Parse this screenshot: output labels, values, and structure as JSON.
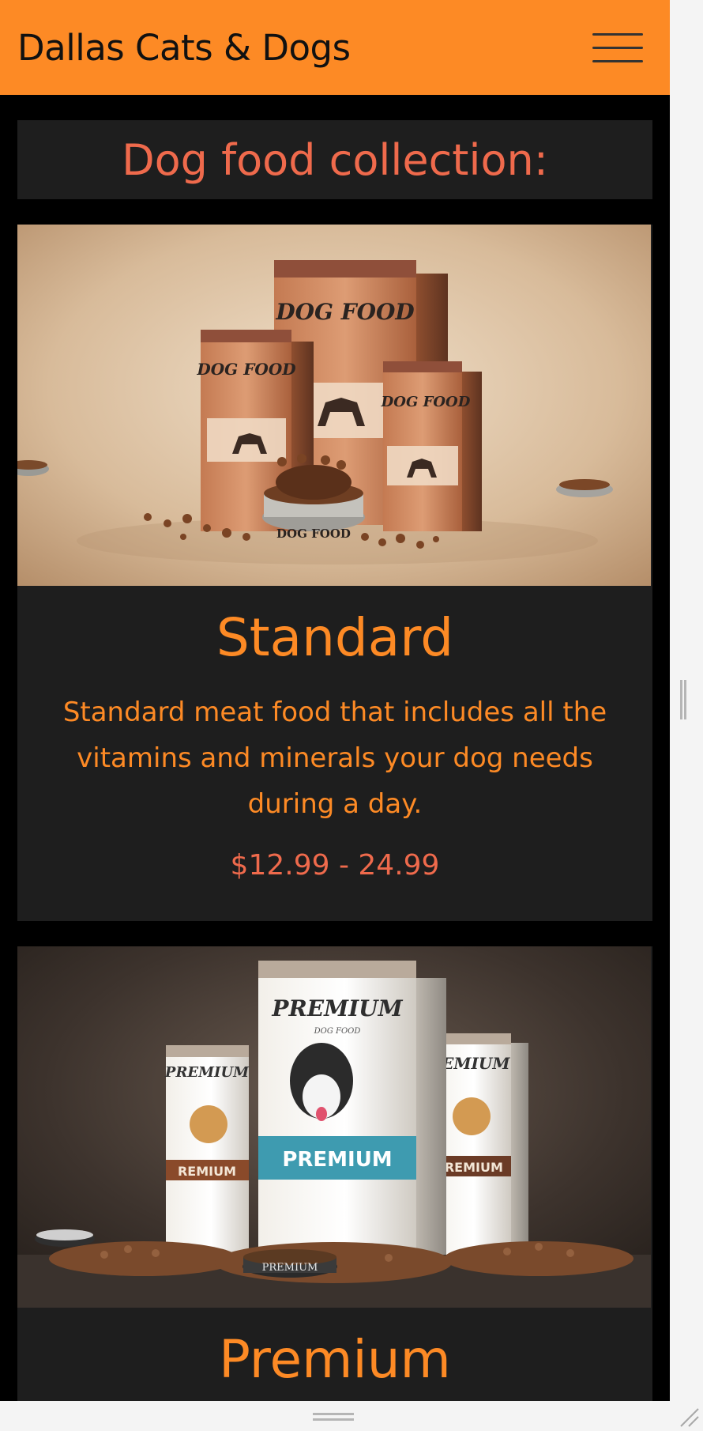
{
  "navbar": {
    "brand": "Dallas Cats & Dogs",
    "menu_icon": "hamburger-menu-icon"
  },
  "page": {
    "section_title": "Dog food collection:"
  },
  "products": [
    {
      "title": "Standard",
      "description": "Standard meat food that includes all the vitamins and minerals your dog needs during a day.",
      "price": "$12.99 - 24.99",
      "image_labels": [
        "DOG FOOD",
        "DOG FOOD",
        "DOG FOOD",
        "DOG FOOD"
      ]
    },
    {
      "title": "Premium",
      "image_labels": [
        "PREMIUM",
        "DOG FOOD",
        "PREMIUM",
        "PREMIUM",
        "REMIUM",
        "PREMIUM"
      ]
    }
  ],
  "colors": {
    "navbar_bg": "#fd8a25",
    "accent_orange": "#fd8a25",
    "accent_coral": "#ef6a4c",
    "card_bg": "#1e1e1e",
    "page_bg": "#000000"
  }
}
